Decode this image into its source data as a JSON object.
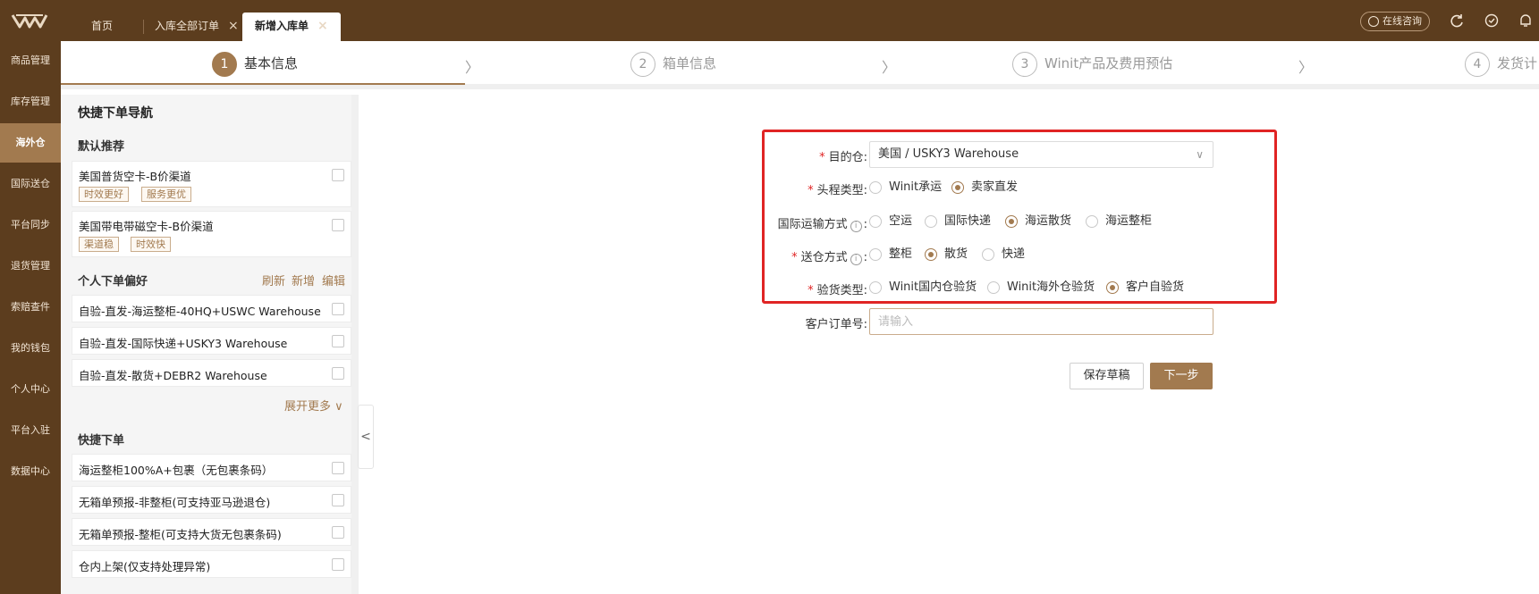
{
  "topbar": {
    "logo_icon": "winit-logo-icon",
    "tabs": [
      {
        "label": "首页"
      },
      {
        "label": "入库全部订单",
        "close": "×"
      },
      {
        "label": "新增入库单",
        "close": "×",
        "active": true
      }
    ],
    "consult_label": "在线咨询",
    "icons": [
      "refresh-icon",
      "shield-check-icon",
      "notification-icon"
    ]
  },
  "leftnav": {
    "items": [
      {
        "label": "商品管理"
      },
      {
        "label": "库存管理"
      },
      {
        "label": "海外仓",
        "active": true
      },
      {
        "label": "国际送仓"
      },
      {
        "label": "平台同步"
      },
      {
        "label": "退货管理"
      },
      {
        "label": "索赔查件"
      },
      {
        "label": "我的钱包"
      },
      {
        "label": "个人中心"
      },
      {
        "label": "平台入驻"
      },
      {
        "label": "数据中心"
      }
    ]
  },
  "steps": [
    {
      "num": "1",
      "label": "基本信息",
      "active": true
    },
    {
      "num": "2",
      "label": "箱单信息"
    },
    {
      "num": "3",
      "label": "Winit产品及费用预估"
    },
    {
      "num": "4",
      "label": "发货计"
    }
  ],
  "sidepanel": {
    "title": "快捷下单导航",
    "recommend_title": "默认推荐",
    "recommend": [
      {
        "name": "美国普货空卡-B价渠道",
        "tags": [
          "时效更好",
          "服务更优"
        ]
      },
      {
        "name": "美国带电带磁空卡-B价渠道",
        "tags": [
          "渠道稳",
          "时效快"
        ]
      }
    ],
    "pref_title": "个人下单偏好",
    "pref_actions": [
      "刷新",
      "新增",
      "编辑"
    ],
    "prefs": [
      "自验-直发-海运整柜-40HQ+USWC Warehouse",
      "自验-直发-国际快递+USKY3 Warehouse",
      "自验-直发-散货+DEBR2 Warehouse"
    ],
    "expand_more": "展开更多",
    "quick_title": "快捷下单",
    "quick": [
      "海运整柜100%A+包裹（无包裹条码）",
      "无箱单预报-非整柜(可支持亚马逊退仓)",
      "无箱单预报-整柜(可支持大货无包裹条码)",
      "仓内上架(仅支持处理异常)"
    ]
  },
  "form": {
    "destination": {
      "label": "目的仓:",
      "value": "美国 / USKY3 Warehouse"
    },
    "first_leg": {
      "label": "头程类型:",
      "options": [
        "Winit承运",
        "卖家直发"
      ],
      "selected": 1
    },
    "transport": {
      "label": "国际运输方式",
      "suffix": ":",
      "options": [
        "空运",
        "国际快递",
        "海运散货",
        "海运整柜"
      ],
      "selected": 2
    },
    "delivery": {
      "label": "送仓方式",
      "suffix": ":",
      "options": [
        "整柜",
        "散货",
        "快递"
      ],
      "selected": 1
    },
    "inspection": {
      "label": "验货类型:",
      "options": [
        "Winit国内仓验货",
        "Winit海外仓验货",
        "客户自验货"
      ],
      "selected": 2
    },
    "customer_order": {
      "label": "客户订单号:",
      "placeholder": "请输入"
    },
    "save_draft": "保存草稿",
    "next": "下一步"
  },
  "colors": {
    "brand_dark": "#5c3d1e",
    "accent": "#a27a4f",
    "highlight": "#e02424"
  }
}
